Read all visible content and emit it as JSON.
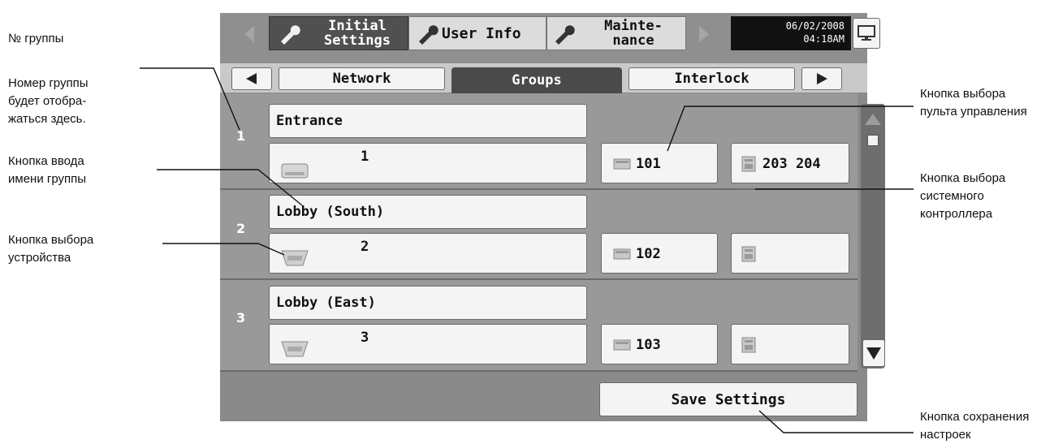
{
  "annotations": {
    "group_no_title": "№ группы",
    "group_no_desc": "Номер группы\nбудет отобра-\nжаться здесь.",
    "name_button": "Кнопка ввода\nимени группы",
    "device_button": "Кнопка выбора\nустройства",
    "remote_button": "Кнопка выбора\nпульта управления",
    "system_button": "Кнопка выбора\nсистемного\nконтроллера",
    "save_button": "Кнопка сохранения\nнастроек"
  },
  "tabs_top": {
    "initial_settings": "Initial\nSettings",
    "user_info": "User Info",
    "maintenance": "Mainte-\nnance",
    "date": "06/02/2008",
    "time": "04:18AM"
  },
  "subtabs": {
    "network": "Network",
    "groups": "Groups",
    "interlock": "Interlock"
  },
  "groups": [
    {
      "number": "1",
      "name": "Entrance",
      "device": "1",
      "remote": "101",
      "system": "203 204"
    },
    {
      "number": "2",
      "name": "Lobby (South)",
      "device": "2",
      "remote": "102",
      "system": ""
    },
    {
      "number": "3",
      "name": "Lobby (East)",
      "device": "3",
      "remote": "103",
      "system": ""
    }
  ],
  "footer": {
    "save_label": "Save Settings"
  },
  "colors": {
    "selected_tab": "#4a4a4a",
    "button_face": "#f4f4f4",
    "panel": "#8a8a8a"
  }
}
